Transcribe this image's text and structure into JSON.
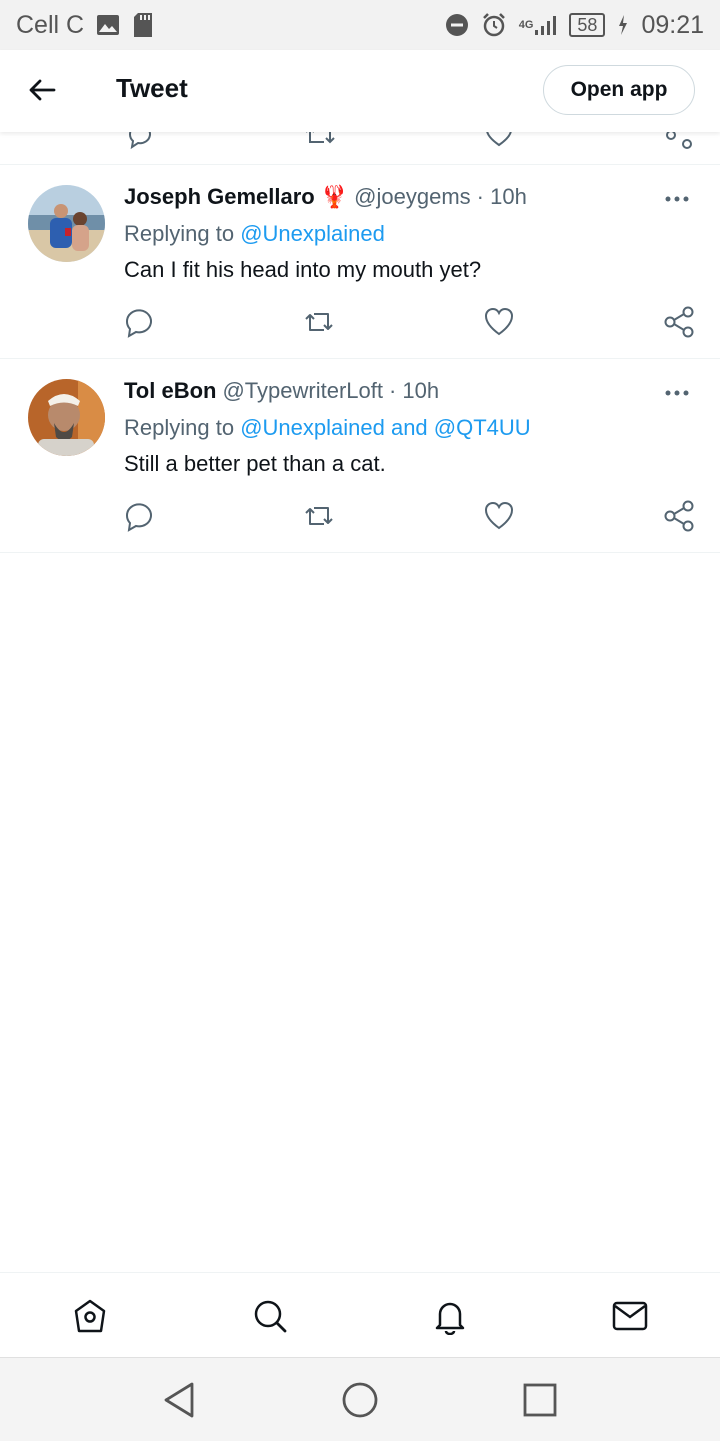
{
  "status_bar": {
    "carrier": "Cell C",
    "network": "4G",
    "battery": "58",
    "time": "09:21"
  },
  "header": {
    "title": "Tweet",
    "open_app_label": "Open app"
  },
  "tweets": [
    {
      "name": "Joseph Gemellaro",
      "emoji": "🦞",
      "handle": "@joeygems",
      "time": "· 10h",
      "replying_prefix": "Replying to",
      "replying_to": "@Unexplained",
      "text": "Can I fit his head into my mouth yet?"
    },
    {
      "name": "Tol eBon",
      "handle": "@TypewriterLoft",
      "time": "· 10h",
      "replying_prefix": "Replying to",
      "replying_to": "@Unexplained and @QT4UU",
      "text": "Still a better pet than a cat."
    }
  ],
  "icons": {
    "reply": "reply-icon",
    "retweet": "retweet-icon",
    "like": "like-icon",
    "share": "share-icon",
    "bottom_nav": [
      "home-icon",
      "search-icon",
      "notifications-icon",
      "messages-icon"
    ],
    "system_nav": [
      "back-triangle-icon",
      "home-circle-icon",
      "recents-square-icon"
    ]
  },
  "colors": {
    "accent": "#1d9bf0",
    "secondary_text": "#536471",
    "primary_text": "#0f1419"
  }
}
